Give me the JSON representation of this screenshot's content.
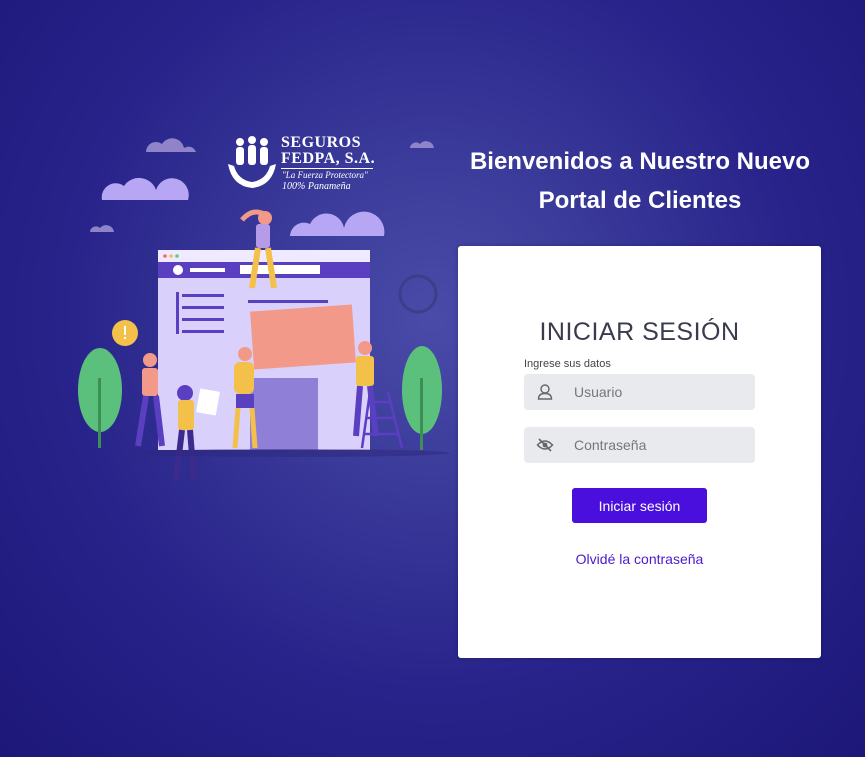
{
  "logo": {
    "line1": "SEGUROS",
    "line2": "FEDPA, S.A.",
    "tagline": "\"La Fuerza Protectora\"",
    "subtag": "100% Panameña"
  },
  "welcome": {
    "line1": "Bienvenidos a Nuestro Nuevo",
    "line2": "Portal de Clientes"
  },
  "login": {
    "title": "INICIAR SESIÓN",
    "hint": "Ingrese sus datos",
    "username_placeholder": "Usuario",
    "password_placeholder": "Contraseña",
    "submit_label": "Iniciar sesión",
    "forgot_label": "Olvidé la contraseña"
  },
  "colors": {
    "background": "#28238a",
    "accent": "#4a0fdc",
    "link": "#4a1acc",
    "field_bg": "#e9eaee"
  },
  "icons": {
    "username": "user-icon",
    "password": "eye-slash-icon"
  }
}
